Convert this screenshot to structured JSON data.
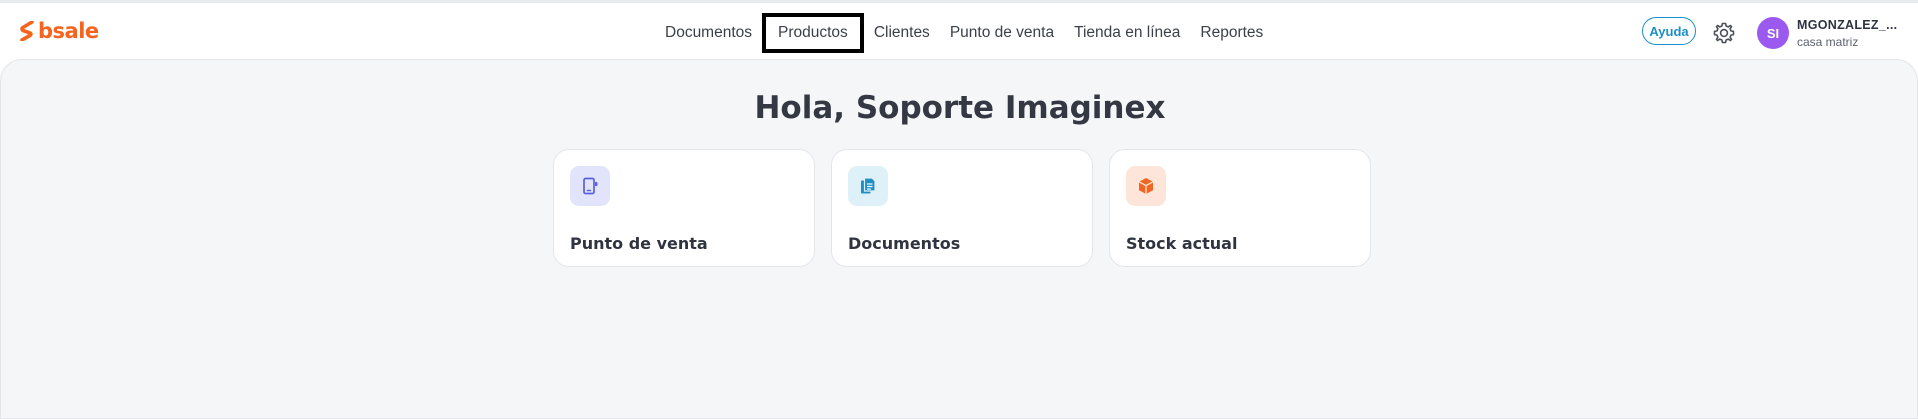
{
  "brand": {
    "name": "bsale",
    "color": "#f5641f"
  },
  "nav": {
    "items": [
      {
        "label": "Documentos"
      },
      {
        "label": "Productos",
        "focused": true
      },
      {
        "label": "Clientes"
      },
      {
        "label": "Punto de venta"
      },
      {
        "label": "Tienda en línea"
      },
      {
        "label": "Reportes"
      }
    ]
  },
  "header": {
    "help_label": "Ayuda",
    "settings_icon": "gear-icon",
    "avatar_initials": "SI",
    "avatar_color": "#9b59f0",
    "user_name": "MGONZALEZ_...",
    "branch": "casa matriz"
  },
  "main": {
    "greeting": "Hola, Soporte Imaginex",
    "cards": [
      {
        "title": "Punto de venta",
        "icon": "tablet-icon",
        "icon_bg": "#e2e4fb",
        "icon_color": "#5a5fe0"
      },
      {
        "title": "Documentos",
        "icon": "document-icon",
        "icon_bg": "#dff1f8",
        "icon_color": "#1f8fc4"
      },
      {
        "title": "Stock actual",
        "icon": "box-icon",
        "icon_bg": "#fde5da",
        "icon_color": "#f26522"
      }
    ]
  }
}
